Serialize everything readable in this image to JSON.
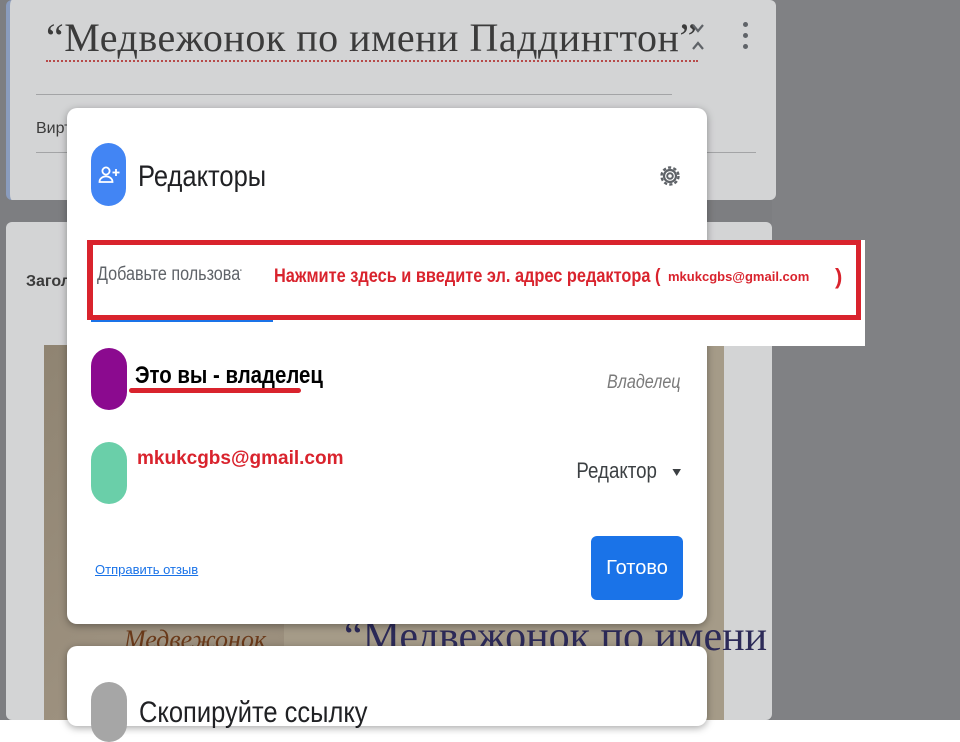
{
  "background_form": {
    "title": "“Медвежонок по имени Паддингтон”",
    "description_label": "Вирту",
    "question_header": "Загол",
    "image_text_main": "“Медвежонок по имени",
    "image_text_secondary": "Медвежонок"
  },
  "editors_dialog": {
    "title": "Редакторы",
    "add_people_placeholder": "Добавьте пользователей и",
    "owner": {
      "name": "Это вы - владелец",
      "role": "Владелец"
    },
    "editor": {
      "email": "mkukcgbs@gmail.com",
      "role": "Редактор"
    },
    "feedback_link": "Отправить отзыв",
    "done_button": "Готово"
  },
  "link_dialog": {
    "title": "Скопируйте ссылку"
  },
  "annotation": {
    "instruction": "Нажмите здесь и введите эл. адрес редактора (",
    "email": "mkukcgbs@gmail.com",
    "closing": ")"
  },
  "colors": {
    "accent": "#1a73e8",
    "annotation_red": "#d9232d",
    "owner_avatar": "#8b0a8f",
    "editor_avatar": "#6acfa9"
  },
  "icons": [
    "person-add-icon",
    "gear-icon",
    "collapse-icon",
    "more-vert-icon",
    "dropdown-caret-icon"
  ]
}
